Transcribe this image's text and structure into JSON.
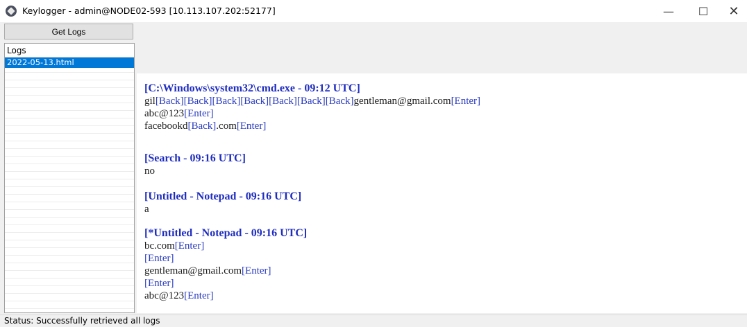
{
  "window": {
    "title": "Keylogger - admin@NODE02-593 [10.113.107.202:52177]",
    "controls": {
      "minimize": "—",
      "maximize": "☐",
      "close": "✕"
    }
  },
  "toolbar": {
    "get_logs_label": "Get Logs"
  },
  "sidebar": {
    "header": "Logs",
    "items": [
      {
        "label": "2022-05-13.html",
        "selected": true
      }
    ]
  },
  "log": {
    "blocks": [
      {
        "title": "[C:\\Windows\\system32\\cmd.exe - 09:12 UTC]",
        "lines": [
          [
            {
              "t": "gil"
            },
            {
              "k": "[Back]"
            },
            {
              "k": "[Back]"
            },
            {
              "k": "[Back]"
            },
            {
              "k": "[Back]"
            },
            {
              "k": "[Back]"
            },
            {
              "k": "[Back]"
            },
            {
              "k": "[Back]"
            },
            {
              "t": "gentleman@gmail.com"
            },
            {
              "k": "[Enter]"
            }
          ],
          [
            {
              "t": "abc@123"
            },
            {
              "k": "[Enter]"
            }
          ],
          [
            {
              "t": "facebookd"
            },
            {
              "k": "[Back]"
            },
            {
              "t": ".com"
            },
            {
              "k": "[Enter]"
            }
          ]
        ]
      },
      {
        "title": "[Search - 09:16 UTC]",
        "lines": [
          [
            {
              "t": "no"
            }
          ]
        ]
      },
      {
        "title": "[Untitled - Notepad - 09:16 UTC]",
        "lines": [
          [
            {
              "t": "a"
            }
          ]
        ]
      },
      {
        "title": "[*Untitled - Notepad - 09:16 UTC]",
        "lines": [
          [
            {
              "t": "bc.com"
            },
            {
              "k": "[Enter]"
            }
          ],
          [
            {
              "k": "[Enter]"
            }
          ],
          [
            {
              "t": "gentleman@gmail.com"
            },
            {
              "k": "[Enter]"
            }
          ],
          [
            {
              "k": "[Enter]"
            }
          ],
          [
            {
              "t": "abc@123"
            },
            {
              "k": "[Enter]"
            }
          ]
        ]
      }
    ]
  },
  "status": {
    "text": "Status: Successfully retrieved all logs"
  },
  "colors": {
    "block_title": "#1f2dbf",
    "keyword": "#2a3cbf",
    "selection": "#0078d7"
  }
}
